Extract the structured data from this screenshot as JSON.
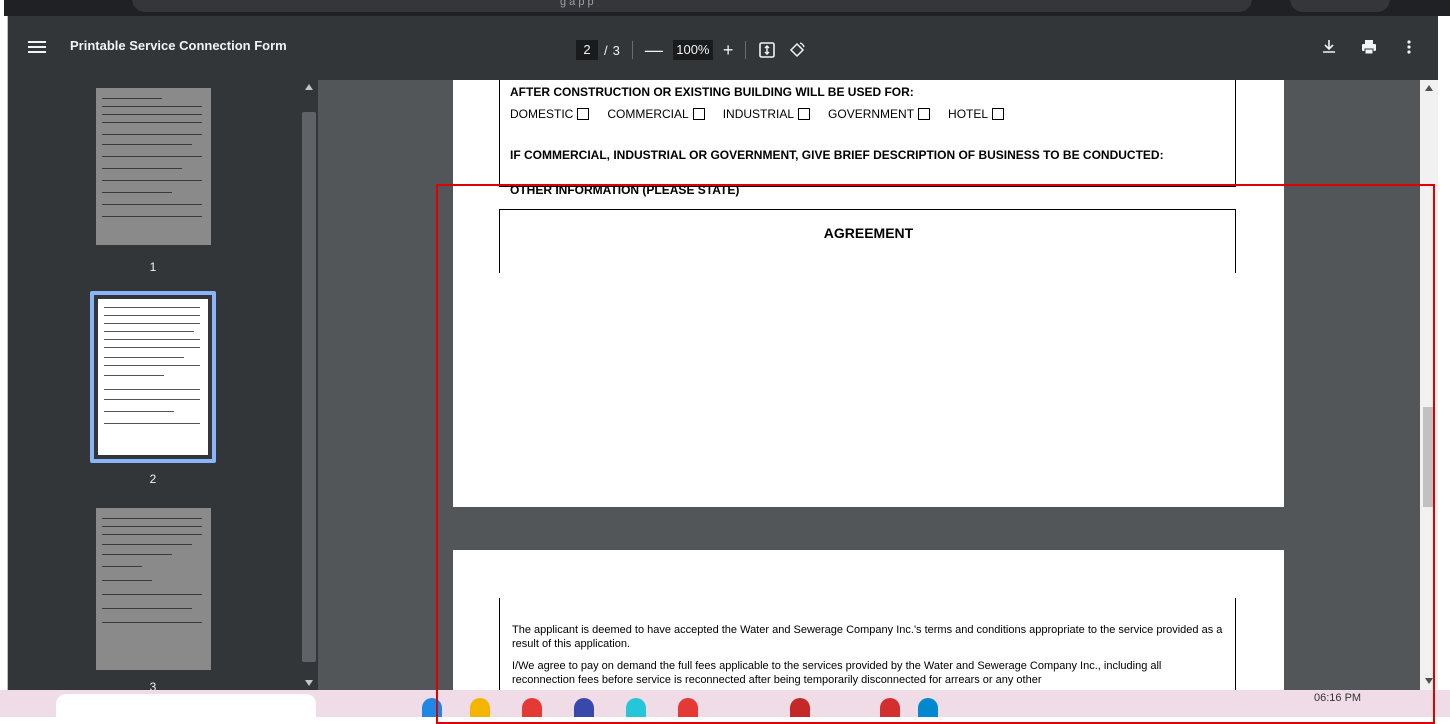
{
  "browser": {
    "omnibox_fragment": "g    a   p   p"
  },
  "toolbar": {
    "title": "Printable Service Connection Form",
    "current_page": "2",
    "page_separator": "/",
    "total_pages": "3",
    "zoom_out": "—",
    "zoom_value": "100%",
    "zoom_in": "+",
    "icons": [
      "menu-icon",
      "fit-page-icon",
      "rotate-icon",
      "download-icon",
      "print-icon",
      "more-vert-icon"
    ]
  },
  "sidebar": {
    "thumbnails": [
      {
        "label": "1",
        "selected": false
      },
      {
        "label": "2",
        "selected": true
      },
      {
        "label": "3",
        "selected": false
      }
    ]
  },
  "document": {
    "section_heading": "AFTER CONSTRUCTION OR EXISTING BUILDING WILL BE USED FOR:",
    "usage_options": [
      "DOMESTIC",
      "COMMERCIAL",
      "INDUSTRIAL",
      "GOVERNMENT",
      "HOTEL"
    ],
    "business_heading": "IF COMMERCIAL, INDUSTRIAL OR GOVERNMENT, GIVE BRIEF DESCRIPTION OF BUSINESS TO BE CONDUCTED:",
    "other_heading": "OTHER INFORMATION (PLEASE STATE)",
    "agreement_title": "AGREEMENT",
    "paragraph_1": "The applicant is deemed to have accepted the Water and Sewerage Company Inc.'s terms and conditions appropriate to the service provided as a result of this application.",
    "paragraph_2": "I/We agree to pay on demand the full fees applicable to the services provided by the Water and Sewerage Company Inc., including all reconnection fees before service is reconnected after being temporarily disconnected for arrears or any other"
  },
  "taskbar": {
    "clock": "06:16 PM"
  },
  "colors": {
    "toolbar_bg": "#323639",
    "viewer_bg": "#525659",
    "selected_thumb_border": "#8ab4f8",
    "annotation_red": "#e00000"
  }
}
